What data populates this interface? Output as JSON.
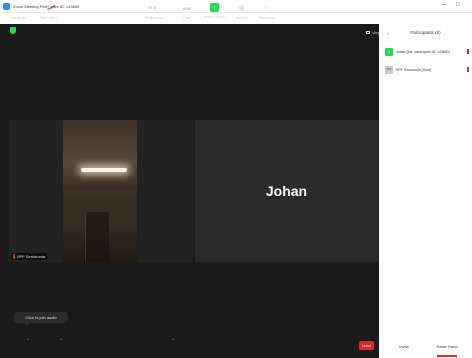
{
  "window": {
    "title": "Zoom Meeting Participant ID: 143660",
    "minimize_glyph": "–",
    "maximize_glyph": "□"
  },
  "meeting": {
    "view_label": "View",
    "tile_left_name": "SPF Senioronia",
    "tile_right_name": "Johan",
    "audio_tooltip": "Click to join audio"
  },
  "toolbar": {
    "join_audio_label": "Join Audio",
    "start_video_label": "Start Video",
    "participants_label": "Participants",
    "participants_count": "2",
    "chat_label": "Chat",
    "share_screen_label": "Share Screen",
    "record_label": "Record",
    "reactions_label": "Reactions",
    "leave_label": "Leave",
    "chevron_glyph": "^"
  },
  "participants_panel": {
    "title": "Participants (2)",
    "collapse_glyph": "⌄",
    "items": [
      {
        "avatar": "J",
        "name": "Johan (Me, participant ID: 143660)"
      },
      {
        "avatar": "SPF",
        "name": "SPF Senioronia (Host)"
      }
    ],
    "invite_label": "Invite",
    "raise_hand_label": "Raise Hand"
  },
  "colors": {
    "accent_green": "#23d959",
    "leave_red": "#e02828",
    "meeting_bg": "#1a1a1a",
    "zoom_blue": "#2d8cff"
  }
}
